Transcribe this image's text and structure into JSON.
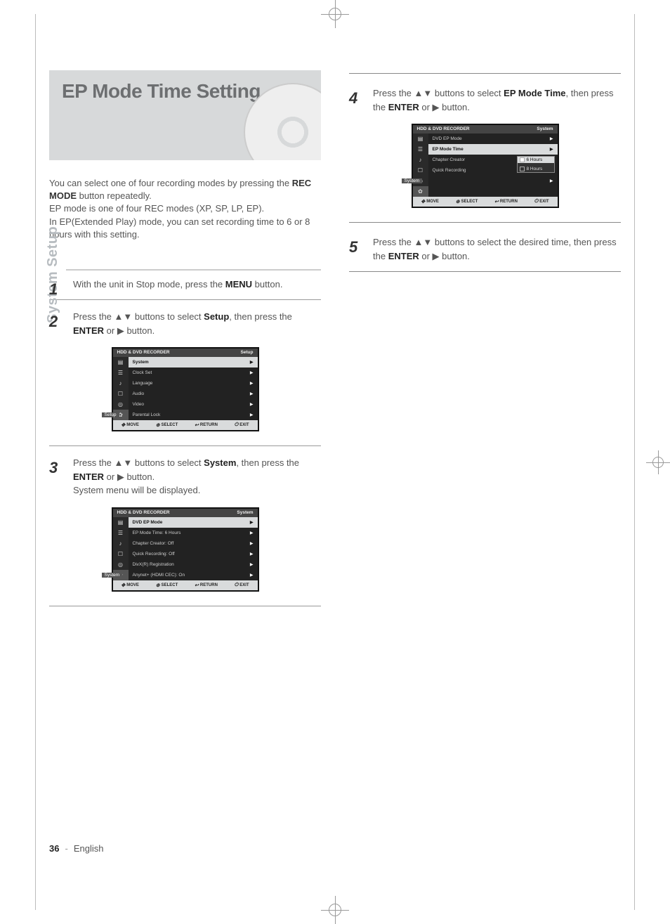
{
  "page_number": "36",
  "language_footer": "English",
  "side_tab": "System Setup",
  "title": "EP Mode Time Setting",
  "intro_parts": {
    "l1a": "You can select one of four recording modes by pressing the ",
    "l1b": "REC MODE",
    "l1c": " button repeatedly.",
    "l2": "EP mode is one of four REC modes (XP, SP, LP, EP).",
    "l3": "In EP(Extended Play) mode, you can set recording time to 6 or 8 hours with this setting."
  },
  "steps": {
    "s1": {
      "num": "1",
      "a": "With the unit in Stop mode, press the ",
      "b": "MENU",
      "c": " button."
    },
    "s2": {
      "num": "2",
      "a": "Press the ▲▼ buttons to select ",
      "b": "Setup",
      "c": ", then press the ",
      "d": "ENTER",
      "e": " or ▶ button."
    },
    "s3": {
      "num": "3",
      "a": "Press the ▲▼ buttons to select ",
      "b": "System",
      "c": ", then press the ",
      "d": "ENTER",
      "e": " or ▶ button.",
      "f": "System menu will be displayed."
    },
    "s4": {
      "num": "4",
      "a": "Press the  ▲▼ buttons to select ",
      "b": "EP Mode Time",
      "c": ", then press the ",
      "d": "ENTER",
      "e": " or ▶ button."
    },
    "s5": {
      "num": "5",
      "a": "Press the ▲▼ buttons to select the desired time, then press the ",
      "d": "ENTER",
      "e": " or ▶ button."
    }
  },
  "osd_common": {
    "rec_label": "HDD & DVD RECORDER",
    "menu_label_setup": "Setup",
    "menu_label_system": "System",
    "footer_move": "MOVE",
    "footer_select": "SELECT",
    "footer_return": "RETURN",
    "footer_exit": "EXIT"
  },
  "osd1": {
    "rows": [
      "System",
      "Clock Set",
      "Language",
      "Audio",
      "Video",
      "Parental Lock"
    ],
    "hilite_index": 0,
    "sub_label": "Setup"
  },
  "osd2": {
    "rows": [
      "DVD EP Mode",
      "EP Mode Time",
      "Chapter Creator",
      "Quick Recording",
      "DivX(R) Registration",
      "Anynet+ (HDMI CEC)"
    ],
    "right_values": [
      "",
      ": 6 Hours",
      ": Off",
      ": Off",
      "",
      ": On"
    ],
    "hilite_index": 0,
    "sub_label": "System"
  },
  "osd3": {
    "rows": [
      "DVD EP Mode",
      "EP Mode Time",
      "Chapter Creator",
      "Quick Recording"
    ],
    "hilite_index": 1,
    "sub_label": "System",
    "submenu": [
      "6 Hours",
      "8 Hours"
    ],
    "sub_hilite": 0
  },
  "chart_data": null
}
